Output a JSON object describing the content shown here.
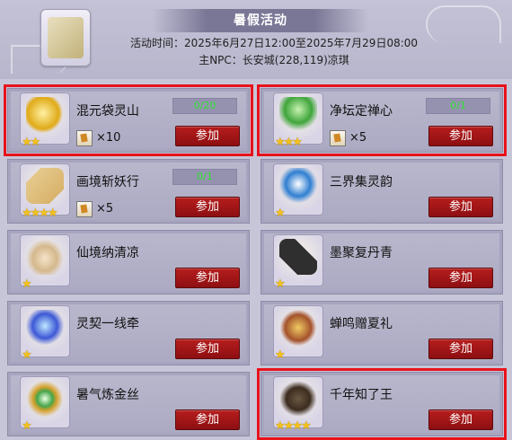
{
  "header": {
    "title": "暑假活动",
    "time_line": "活动时间：2025年6月27日12:00至2025年7月29日08:00",
    "npc_line": "主NPC：长安城(228,119)凉琪",
    "icon": "event-scroll-icon"
  },
  "join_label": "参加",
  "activities": [
    {
      "name": "混元袋灵山",
      "progress": "0/20",
      "reward_count": "×10",
      "stars": "★★",
      "icon": "gold-ingots-icon",
      "highlighted": true
    },
    {
      "name": "净坛定禅心",
      "progress": "0/1",
      "reward_count": "×5",
      "stars": "★★★",
      "icon": "jade-plant-icon",
      "highlighted": true
    },
    {
      "name": "画境斩妖行",
      "progress": "0/1",
      "reward_count": "×5",
      "stars": "★★★★",
      "icon": "scroll-icon",
      "highlighted": false
    },
    {
      "name": "三界集灵韵",
      "progress": "",
      "reward_count": "",
      "stars": "★",
      "icon": "vase-icon",
      "highlighted": false
    },
    {
      "name": "仙境纳清凉",
      "progress": "",
      "reward_count": "",
      "stars": "★",
      "icon": "bowl-icon",
      "highlighted": false
    },
    {
      "name": "墨聚复丹青",
      "progress": "",
      "reward_count": "",
      "stars": "★",
      "icon": "inkstick-icon",
      "highlighted": false
    },
    {
      "name": "灵契一线牵",
      "progress": "",
      "reward_count": "",
      "stars": "★",
      "icon": "blue-flame-icon",
      "highlighted": false
    },
    {
      "name": "蝉鸣赠夏礼",
      "progress": "",
      "reward_count": "",
      "stars": "★",
      "icon": "giftbox-icon",
      "highlighted": false
    },
    {
      "name": "暑气炼金丝",
      "progress": "",
      "reward_count": "",
      "stars": "★",
      "icon": "gold-thread-icon",
      "highlighted": false
    },
    {
      "name": "千年知了王",
      "progress": "",
      "reward_count": "",
      "stars": "★★★★",
      "icon": "cicada-icon",
      "highlighted": true
    }
  ]
}
